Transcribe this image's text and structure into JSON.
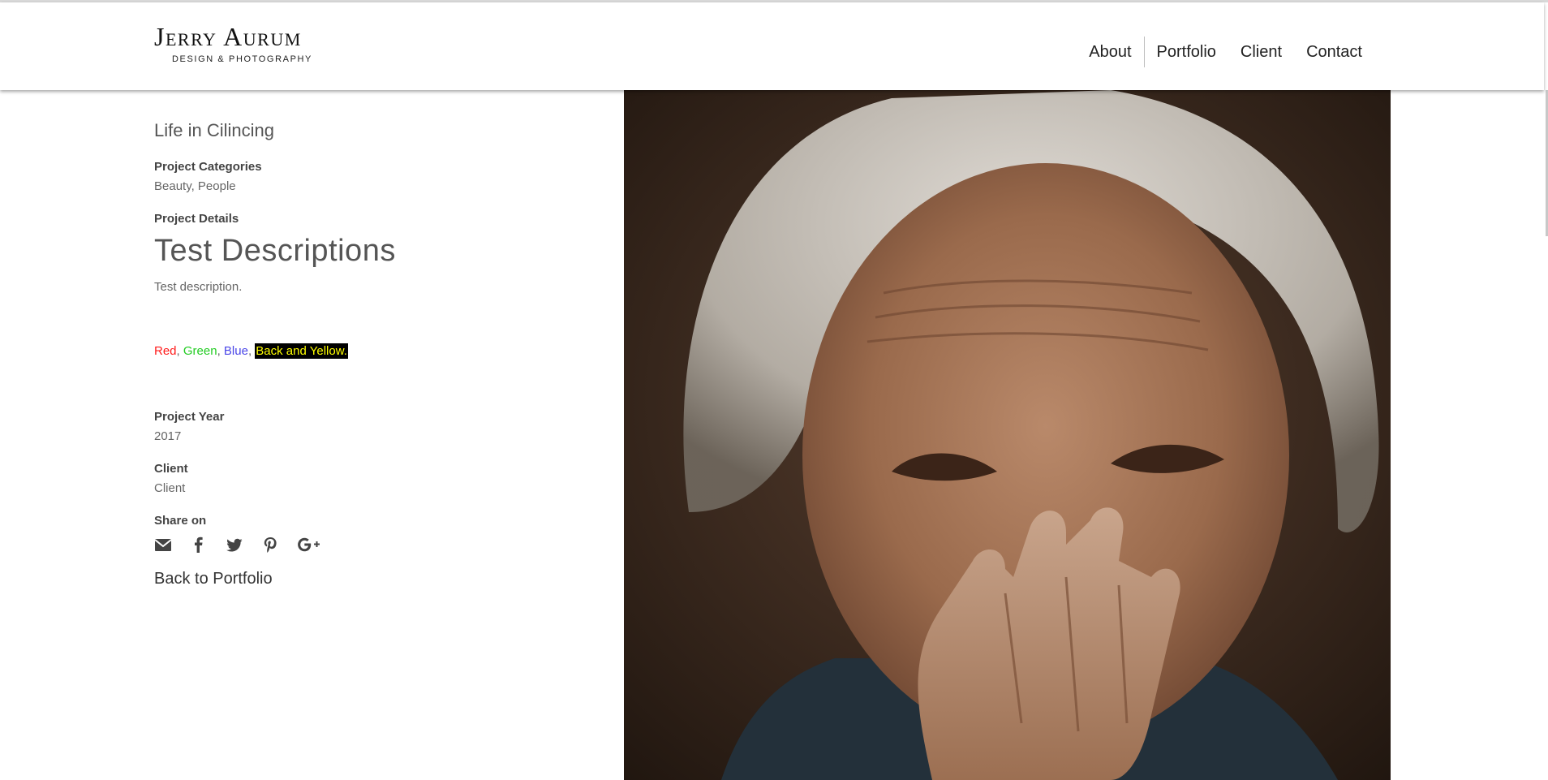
{
  "header": {
    "logo_name": "Jerry Aurum",
    "logo_tagline": "DESIGN & PHOTOGRAPHY",
    "nav": [
      "About",
      "Portfolio",
      "Client",
      "Contact"
    ]
  },
  "project": {
    "title": "Life in Cilincing",
    "categories_label": "Project Categories",
    "categories_value": "Beauty, People",
    "details_label": "Project Details",
    "details_heading": "Test Descriptions",
    "details_text": "Test description.",
    "colors": {
      "red": "Red",
      "green": "Green",
      "blue": "Blue",
      "highlight": "Back and Yellow",
      "sep": ",",
      "end": "."
    },
    "year_label": "Project Year",
    "year_value": "2017",
    "client_label": "Client",
    "client_value": "Client",
    "share_label": "Share on",
    "share_icons": [
      "email-icon",
      "facebook-icon",
      "twitter-icon",
      "pinterest-icon",
      "google-plus-icon"
    ],
    "back_link": "Back to Portfolio"
  },
  "colors": {
    "red": "#ff1a1a",
    "green": "#22cc22",
    "blue": "#4a46e8",
    "highlight_bg": "#000000",
    "highlight_fg": "#ffff00"
  }
}
